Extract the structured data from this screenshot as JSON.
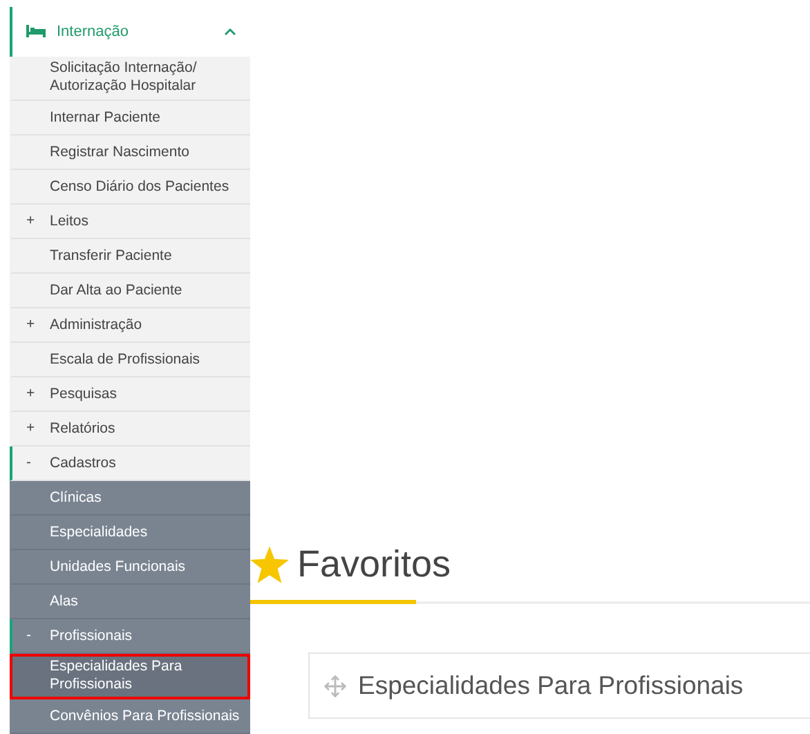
{
  "sidebar": {
    "section": {
      "label": "Internação",
      "expanded": true
    },
    "items": [
      {
        "kind": "link",
        "label": "Solicitação Internação/ Autorização Hospitalar",
        "selected": false
      },
      {
        "kind": "link",
        "label": "Internar Paciente",
        "selected": false
      },
      {
        "kind": "link",
        "label": "Registrar Nascimento",
        "selected": false
      },
      {
        "kind": "link",
        "label": "Censo Diário dos Pacientes",
        "selected": false
      },
      {
        "kind": "group",
        "marker": "+",
        "label": "Leitos",
        "expanded": false
      },
      {
        "kind": "link",
        "label": "Transferir Paciente",
        "selected": false
      },
      {
        "kind": "link",
        "label": "Dar Alta ao Paciente",
        "selected": false
      },
      {
        "kind": "group",
        "marker": "+",
        "label": "Administração",
        "expanded": false
      },
      {
        "kind": "link",
        "label": "Escala de Profissionais",
        "selected": false
      },
      {
        "kind": "group",
        "marker": "+",
        "label": "Pesquisas",
        "expanded": false
      },
      {
        "kind": "group",
        "marker": "+",
        "label": "Relatórios",
        "expanded": false
      },
      {
        "kind": "group",
        "marker": "-",
        "label": "Cadastros",
        "expanded": true,
        "children": [
          {
            "kind": "link",
            "label": "Clínicas",
            "selected": false
          },
          {
            "kind": "link",
            "label": "Especialidades",
            "selected": false
          },
          {
            "kind": "link",
            "label": "Unidades Funcionais",
            "selected": false
          },
          {
            "kind": "link",
            "label": "Alas",
            "selected": false
          },
          {
            "kind": "group",
            "marker": "-",
            "label": "Profissionais",
            "expanded": true,
            "children": [
              {
                "kind": "link",
                "label": "Especialidades Para Profissionais",
                "selected": true
              },
              {
                "kind": "link",
                "label": "Convênios Para Profissionais",
                "selected": false
              }
            ]
          }
        ]
      }
    ]
  },
  "favorites": {
    "title": "Favoritos",
    "cards": [
      {
        "label": "Especialidades Para Profissionais"
      }
    ]
  }
}
